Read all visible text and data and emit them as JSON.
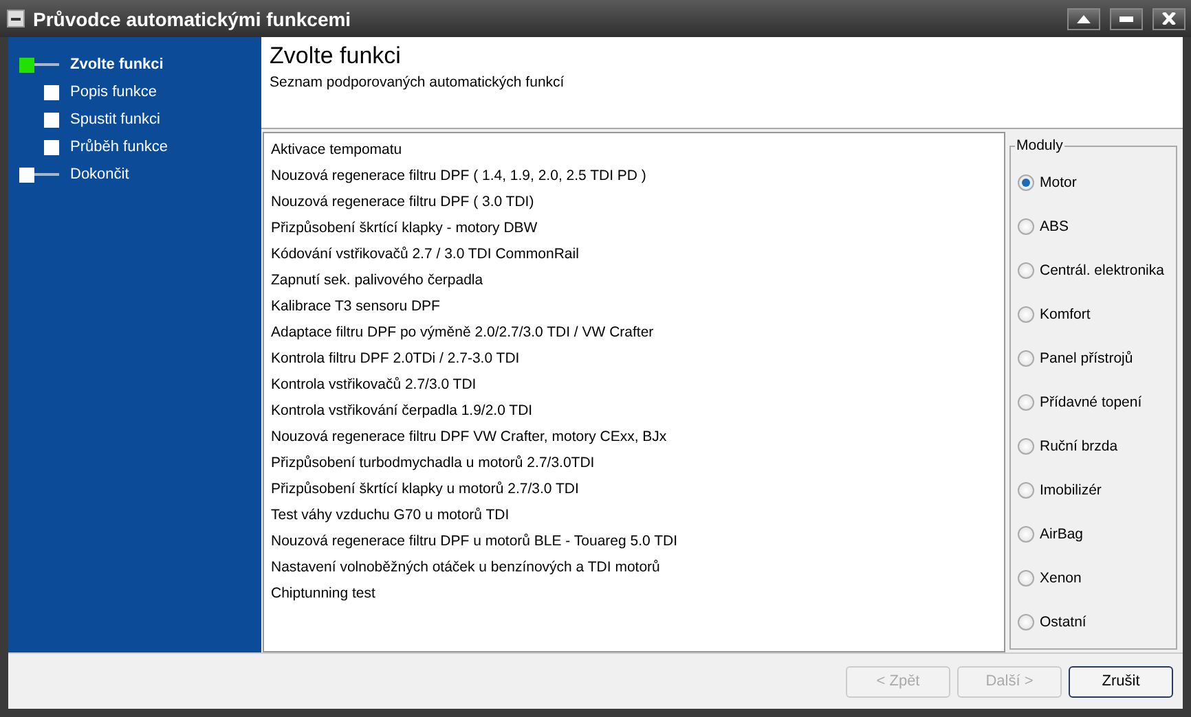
{
  "window": {
    "title": "Průvodce automatickými funkcemi"
  },
  "steps": [
    {
      "label": "Zvolte funkci",
      "selected": true,
      "children": [
        {
          "label": "Popis funkce",
          "selected": false
        },
        {
          "label": "Spustit funkci",
          "selected": false
        },
        {
          "label": "Průběh funkce",
          "selected": false
        }
      ]
    },
    {
      "label": "Dokončit",
      "selected": false
    }
  ],
  "header": {
    "title": "Zvolte funkci",
    "subtitle": "Seznam podporovaných automatických funkcí"
  },
  "functions": [
    "Aktivace tempomatu",
    "Nouzová regenerace filtru DPF ( 1.4, 1.9, 2.0, 2.5 TDI PD )",
    "Nouzová regenerace filtru DPF ( 3.0 TDI)",
    "Přizpůsobení škrtící klapky - motory DBW",
    "Kódování vstřikovačů 2.7 / 3.0 TDI CommonRail",
    "Zapnutí sek. palivového čerpadla",
    "Kalibrace T3 sensoru DPF",
    "Adaptace filtru DPF po výměně 2.0/2.7/3.0 TDI / VW Crafter",
    "Kontrola filtru DPF 2.0TDi / 2.7-3.0 TDI",
    "Kontrola vstřikovačů 2.7/3.0 TDI",
    "Kontrola vstřikování čerpadla 1.9/2.0 TDI",
    "Nouzová regenerace filtru DPF VW Crafter, motory CExx, BJx",
    "Přizpůsobení turbodmychadla u motorů 2.7/3.0TDI",
    "Přizpůsobení škrtící klapky u motorů 2.7/3.0 TDI",
    "Test váhy vzduchu G70 u motorů TDI",
    "Nouzová regenerace filtru DPF u motorů BLE - Touareg 5.0 TDI",
    "Nastavení volnoběžných otáček u benzínových a TDI motorů",
    "Chiptunning test"
  ],
  "modules": {
    "title": "Moduly",
    "options": [
      {
        "label": "Motor",
        "selected": true
      },
      {
        "label": "ABS",
        "selected": false
      },
      {
        "label": "Centrál. elektronika",
        "selected": false
      },
      {
        "label": "Komfort",
        "selected": false
      },
      {
        "label": "Panel přístrojů",
        "selected": false
      },
      {
        "label": "Přídavné topení",
        "selected": false
      },
      {
        "label": "Ruční brzda",
        "selected": false
      },
      {
        "label": "Imobilizér",
        "selected": false
      },
      {
        "label": "AirBag",
        "selected": false
      },
      {
        "label": "Xenon",
        "selected": false
      },
      {
        "label": "Ostatní",
        "selected": false
      }
    ]
  },
  "buttons": [
    {
      "label": "< Zpět",
      "disabled": true
    },
    {
      "label": "Další >",
      "disabled": true
    },
    {
      "label": "Zrušit",
      "disabled": false
    }
  ]
}
